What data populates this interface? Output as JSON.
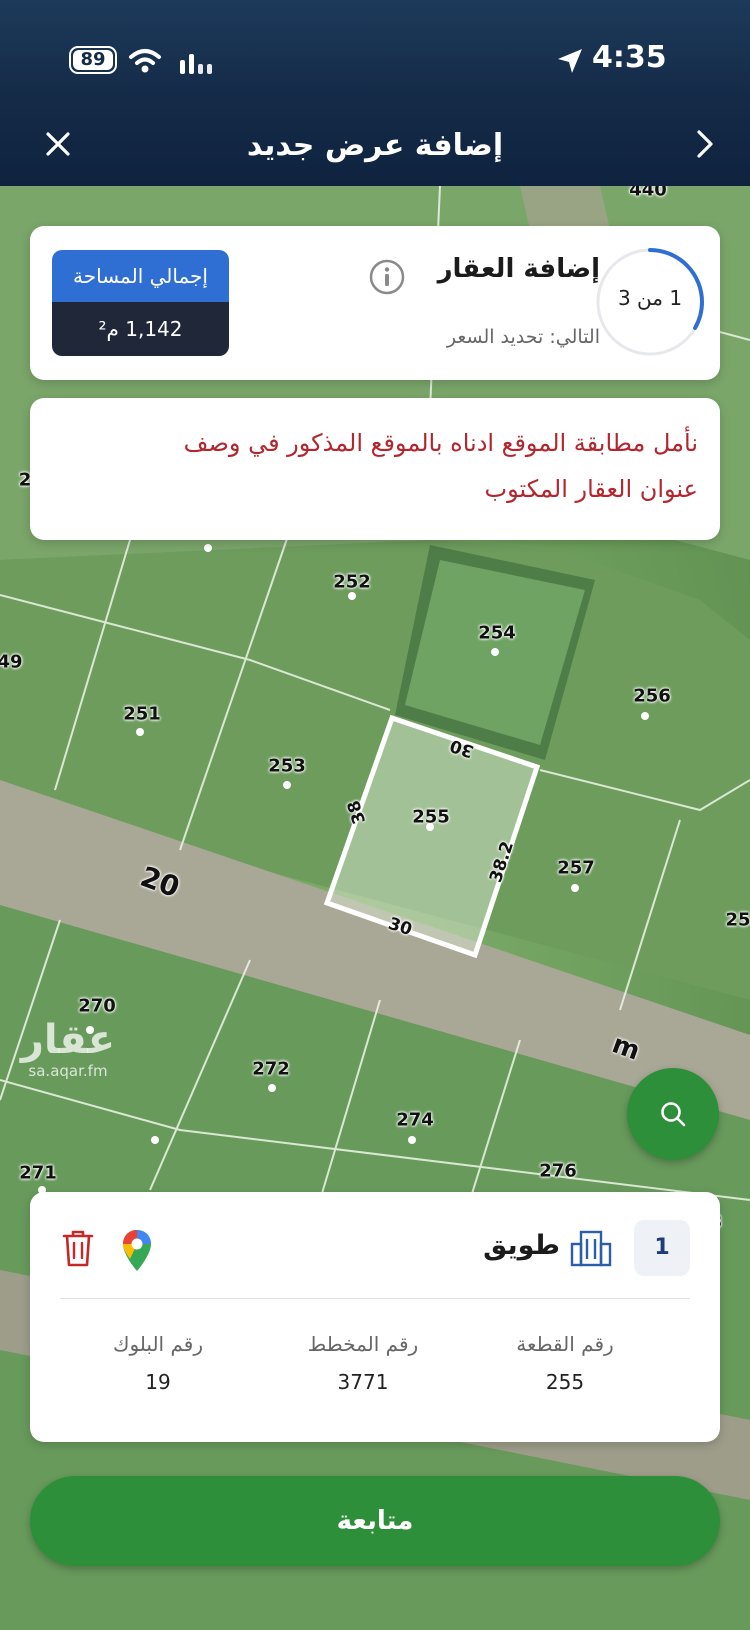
{
  "status_bar": {
    "battery": "89",
    "time": "4:35"
  },
  "header": {
    "title": "إضافة عرض جديد"
  },
  "progress_card": {
    "step_label": "1 من 3",
    "step_fraction": 0.333,
    "title": "إضافة العقار",
    "next_label": "التالي: تحديد السعر",
    "total_area_label": "إجمالي المساحة",
    "total_area_value": "1,142 م²"
  },
  "notice": {
    "text": "نأمل مطابقة الموقع ادناه بالموقع المذكور في وصف عنوان العقار المكتوب"
  },
  "map": {
    "parcels": [
      "252",
      "254",
      "256",
      "251",
      "253",
      "255",
      "257",
      "270",
      "272",
      "274",
      "276",
      "271"
    ],
    "edge_numbers": [
      "49",
      "2",
      "25",
      "3",
      "440"
    ],
    "dimensions": [
      "30",
      "38",
      "38.2",
      "30"
    ],
    "street_numbers": [
      "20",
      "m"
    ],
    "watermark": {
      "brand": "عقار",
      "url": "sa.aqar.fm"
    }
  },
  "property_card": {
    "index": "1",
    "neighborhood": "طويق",
    "fields": [
      {
        "label": "رقم القطعة",
        "value": "255"
      },
      {
        "label": "رقم المخطط",
        "value": "3771"
      },
      {
        "label": "رقم البلوك",
        "value": "19"
      }
    ]
  },
  "continue_button": {
    "label": "متابعة"
  },
  "colors": {
    "accent": "#2e8f3a",
    "header": "#142a47",
    "area_badge_top": "#2f6fd3",
    "area_badge_bottom": "#1f2738",
    "notice_text": "#b3262e",
    "icon_blue": "#2a5ea8",
    "delete_red": "#c62828"
  }
}
